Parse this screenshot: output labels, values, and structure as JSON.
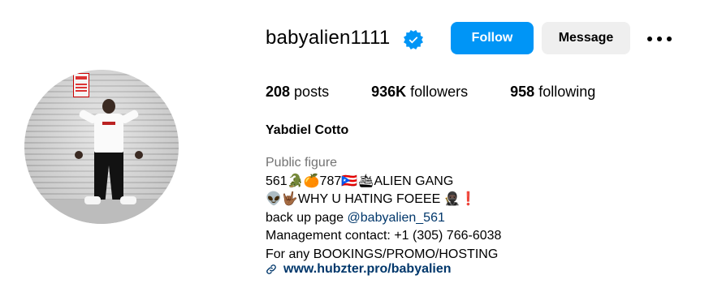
{
  "profile": {
    "username": "babyalien1111",
    "verified": true,
    "follow_label": "Follow",
    "message_label": "Message",
    "stats": {
      "posts_value": "208",
      "posts_label": " posts",
      "followers_value": "936K",
      "followers_label": " followers",
      "following_value": "958",
      "following_label": " following"
    },
    "full_name": "Yabdiel Cotto",
    "category": "Public figure",
    "bio_lines": [
      "561🐊🍊787🇵🇷🛳ALIEN GANG",
      "👽🤟🏾WHY U HATING FOEEE 🥷🏿❗",
      "back up page ",
      "Management contact: +1 (305) 766-6038",
      "For any BOOKINGS/PROMO/HOSTING"
    ],
    "mention": "@babyalien_561",
    "link": "www.hubzter.pro/babyalien"
  },
  "colors": {
    "accent": "#0095f6",
    "secondary_button": "#efefef",
    "muted_text": "#737373",
    "link_text": "#00376b"
  },
  "icons": {
    "verified": "verified-badge-icon",
    "more": "more-options-icon",
    "link": "link-icon"
  }
}
